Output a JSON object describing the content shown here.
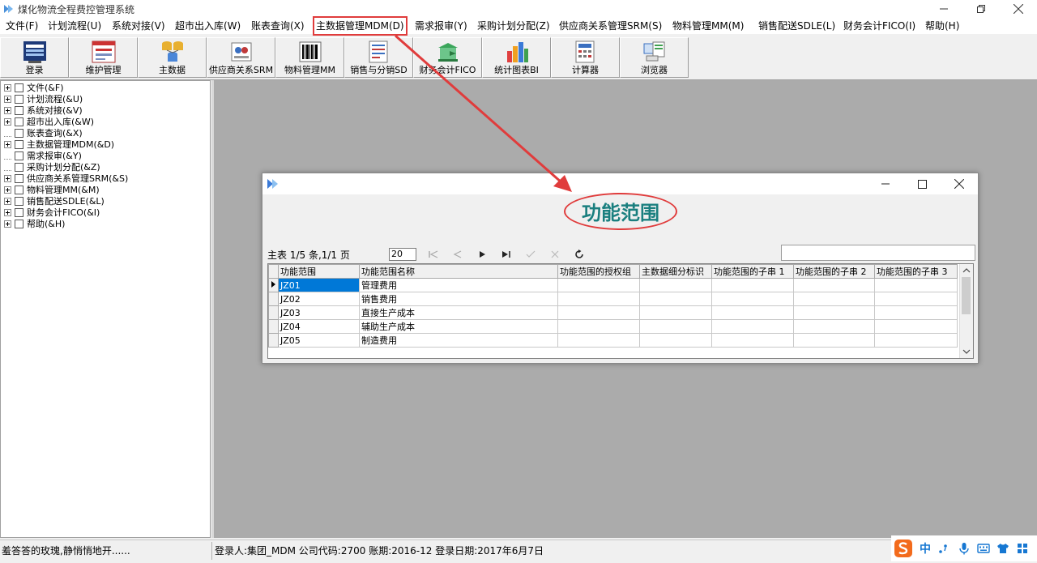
{
  "app": {
    "title": "煤化物流全程费控管理系统"
  },
  "menu": [
    {
      "label": "文件(F)",
      "highlight": false
    },
    {
      "label": "计划流程(U)",
      "highlight": false
    },
    {
      "label": "系统对接(V)",
      "highlight": false
    },
    {
      "label": "超市出入库(W)",
      "highlight": false
    },
    {
      "label": "账表查询(X)",
      "highlight": false
    },
    {
      "label": "主数据管理MDM(D)",
      "highlight": true
    },
    {
      "label": "需求报审(Y)",
      "highlight": false
    },
    {
      "label": "采购计划分配(Z)",
      "highlight": false
    },
    {
      "label": "供应商关系管理SRM(S)",
      "highlight": false
    },
    {
      "label": "物料管理MM(M)",
      "highlight": false
    },
    {
      "label": "销售配送SDLE(L)",
      "highlight": false
    },
    {
      "label": "财务会计FICO(I)",
      "highlight": false
    },
    {
      "label": "帮助(H)",
      "highlight": false
    }
  ],
  "toolbar": [
    {
      "label": "登录",
      "icon": "login-icon"
    },
    {
      "label": "维护管理",
      "icon": "maintenance-icon"
    },
    {
      "label": "主数据",
      "icon": "database-icon"
    },
    {
      "label": "供应商关系SRM",
      "icon": "supplier-icon"
    },
    {
      "label": "物料管理MM",
      "icon": "barcode-icon"
    },
    {
      "label": "销售与分销SD",
      "icon": "sales-icon"
    },
    {
      "label": "财务会计FICO",
      "icon": "finance-icon"
    },
    {
      "label": "统计图表BI",
      "icon": "bar-chart-icon"
    },
    {
      "label": "计算器",
      "icon": "calculator-icon"
    },
    {
      "label": "浏览器",
      "icon": "browser-icon"
    }
  ],
  "tree": [
    {
      "label": "文件(&F)",
      "expandable": true
    },
    {
      "label": "计划流程(&U)",
      "expandable": true
    },
    {
      "label": "系统对接(&V)",
      "expandable": true
    },
    {
      "label": "超市出入库(&W)",
      "expandable": true
    },
    {
      "label": "账表查询(&X)",
      "expandable": false
    },
    {
      "label": "主数据管理MDM(&D)",
      "expandable": true
    },
    {
      "label": "需求报审(&Y)",
      "expandable": false
    },
    {
      "label": "采购计划分配(&Z)",
      "expandable": false
    },
    {
      "label": "供应商关系管理SRM(&S)",
      "expandable": true
    },
    {
      "label": "物料管理MM(&M)",
      "expandable": true
    },
    {
      "label": "销售配送SDLE(&L)",
      "expandable": true
    },
    {
      "label": "财务会计FICO(&I)",
      "expandable": true
    },
    {
      "label": "帮助(&H)",
      "expandable": true
    }
  ],
  "dialog": {
    "heading": "功能范围",
    "nav_status": "主表 1/5 条,1/1 页",
    "page_size": "20",
    "columns": [
      "功能范围",
      "功能范围名称",
      "功能范围的授权组",
      "主数据细分标识",
      "功能范围的子串 1",
      "功能范围的子串 2",
      "功能范围的子串 3"
    ],
    "rows": [
      [
        "JZ01",
        "管理费用",
        "",
        "",
        "",
        "",
        ""
      ],
      [
        "JZ02",
        "销售费用",
        "",
        "",
        "",
        "",
        ""
      ],
      [
        "JZ03",
        "直接生产成本",
        "",
        "",
        "",
        "",
        ""
      ],
      [
        "JZ04",
        "辅助生产成本",
        "",
        "",
        "",
        "",
        ""
      ],
      [
        "JZ05",
        "制造费用",
        "",
        "",
        "",
        "",
        ""
      ]
    ]
  },
  "status": {
    "left": "羞答答的玫瑰,静悄悄地开......",
    "main": "登录人:集团_MDM 公司代码:2700 账期:2016-12 登录日期:2017年6月7日"
  },
  "ime": {
    "mode": "中"
  },
  "colors": {
    "annotation_red": "#e03c3c",
    "heading_teal": "#1a7f7f",
    "selection_blue": "#0078d7",
    "mdi_gray": "#ababab"
  }
}
